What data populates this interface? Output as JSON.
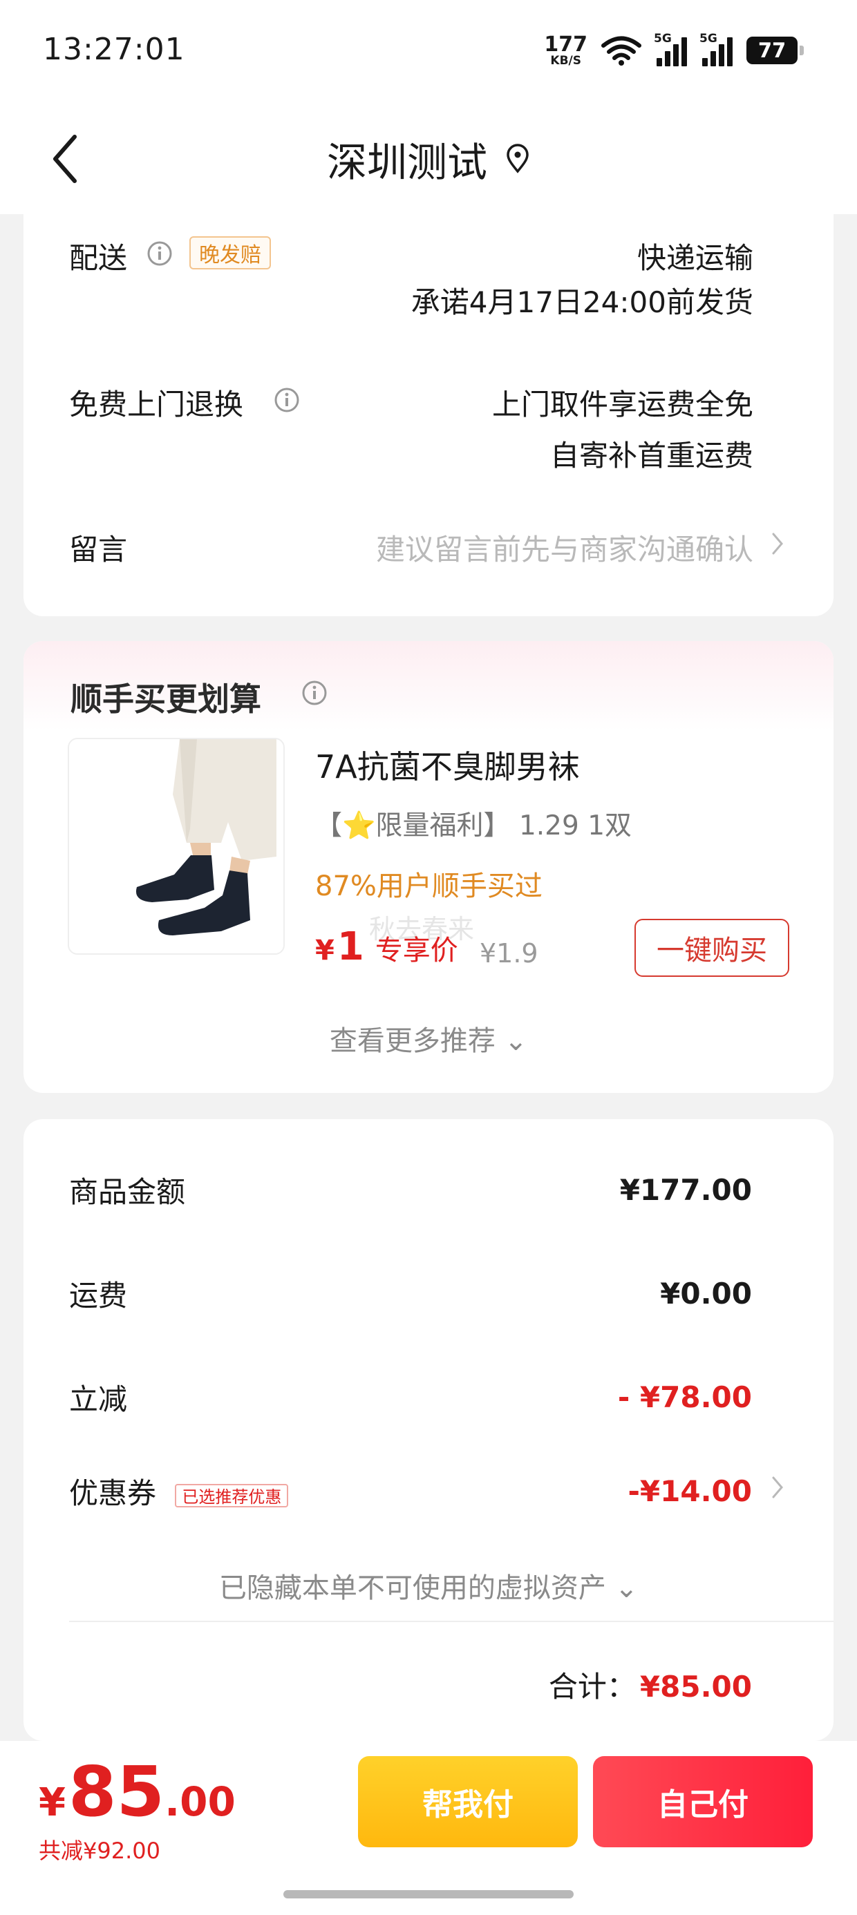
{
  "status_bar": {
    "time": "13:27:01",
    "net_speed_value": "177",
    "net_speed_unit": "KB/S",
    "signal_1_tag": "5G",
    "signal_2_tag": "5G",
    "battery": "77",
    "icons": [
      "wifi-icon",
      "signal-icon",
      "signal-icon",
      "battery-icon"
    ]
  },
  "nav": {
    "title": "深圳测试",
    "back_icon": "chevron-left-icon",
    "location_icon": "location-pin-icon"
  },
  "delivery": {
    "shipping_label": "配送",
    "late_badge": "晚发赔",
    "shipping_method": "快递运输",
    "shipping_promise": "承诺4月17日24:00前发货",
    "return_label": "免费上门退换",
    "return_line1": "上门取件享运费全免",
    "return_line2": "自寄补首重运费",
    "note_label": "留言",
    "note_placeholder": "建议留言前先与商家沟通确认"
  },
  "recommend": {
    "title": "顺手买更划算",
    "product_name": "7A抗菌不臭脚男袜",
    "promo": "【⭐限量福利】 1.29 1双",
    "social_proof": "87%用户顺手买过",
    "ghost_text": "秋去春来",
    "price_symbol": "¥",
    "price": "1",
    "price_label": "专享价",
    "original_price": "¥1.9",
    "buy_button": "一键购买",
    "more": "查看更多推荐 ⌄"
  },
  "price_detail": {
    "goods_label": "商品金额",
    "goods_value": "¥177.00",
    "freight_label": "运费",
    "freight_value": "¥0.00",
    "discount_label": "立减",
    "discount_value": "- ¥78.00",
    "coupon_label": "优惠券",
    "coupon_badge": "已选推荐优惠",
    "coupon_value": "-¥14.00",
    "hidden_assets": "已隐藏本单不可使用的虚拟资产 ⌄",
    "total_label": "合计：",
    "total_value": "¥85.00"
  },
  "bottom": {
    "yen": "¥",
    "amount_int": "85",
    "amount_dec": ".00",
    "saved": "共减¥92.00",
    "help_pay": "帮我付",
    "self_pay": "自己付"
  },
  "colors": {
    "accent_red": "#e02020",
    "orange": "#e08a22",
    "help_pay_yellow": "#ffc21a",
    "self_pay_red": "#ff2f45"
  }
}
